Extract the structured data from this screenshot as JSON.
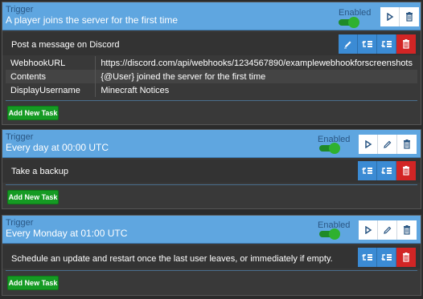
{
  "colors": {
    "header_bg": "#5fa6e0",
    "card_bg": "#393939",
    "task_button": "#3b8bd4",
    "delete_button": "#d22525",
    "add_button": "#159a23",
    "toggle_on": "#2fb12f"
  },
  "cards": [
    {
      "trigger_label": "Trigger",
      "trigger_value": "A player joins the server for the first time",
      "enabled_label": "Enabled",
      "enabled": true,
      "header_buttons": [
        "play-icon",
        "trash-icon"
      ],
      "task": {
        "title": "Post a message on Discord",
        "buttons": [
          "pencil-icon",
          "move-up-icon",
          "move-down-icon",
          "trash-icon"
        ],
        "params": [
          {
            "key": "WebhookURL",
            "value": "https://discord.com/api/webhooks/1234567890/examplewebhookforscreenshots"
          },
          {
            "key": "Contents",
            "value": "{@User} joined the server for the first time"
          },
          {
            "key": "DisplayUsername",
            "value": "Minecraft Notices"
          }
        ]
      },
      "add_label": "Add New Task"
    },
    {
      "trigger_label": "Trigger",
      "trigger_value": "Every day at 00:00 UTC",
      "enabled_label": "Enabled",
      "enabled": true,
      "header_buttons": [
        "play-icon",
        "pencil-icon",
        "trash-icon"
      ],
      "task": {
        "title": "Take a backup",
        "buttons": [
          "move-up-icon",
          "move-down-icon",
          "trash-icon"
        ]
      },
      "add_label": "Add New Task"
    },
    {
      "trigger_label": "Trigger",
      "trigger_value": "Every Monday at 01:00 UTC",
      "enabled_label": "Enabled",
      "enabled": true,
      "header_buttons": [
        "play-icon",
        "pencil-icon",
        "trash-icon"
      ],
      "task": {
        "title": "Schedule an update and restart once the last user leaves, or immediately if empty.",
        "buttons": [
          "move-up-icon",
          "move-down-icon",
          "trash-icon"
        ]
      },
      "add_label": "Add New Task"
    }
  ]
}
